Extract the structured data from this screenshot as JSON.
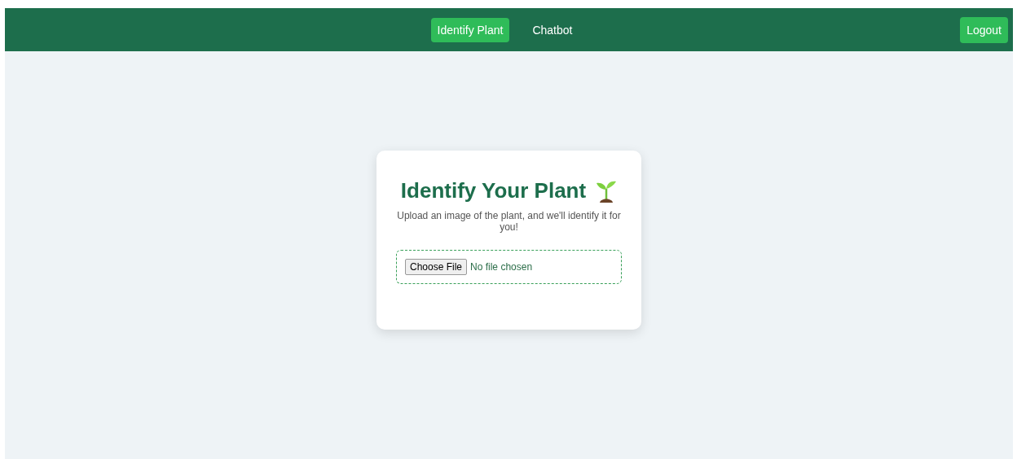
{
  "nav": {
    "tabs": [
      {
        "label": "Identify Plant",
        "selected": true
      },
      {
        "label": "Chatbot",
        "selected": false
      }
    ],
    "logout": "Logout"
  },
  "card": {
    "title": "Identify Your Plant",
    "subtitle": "Upload an image of the plant, and we'll identify it for you!",
    "file_button": "Choose File",
    "file_status": "No file chosen"
  }
}
